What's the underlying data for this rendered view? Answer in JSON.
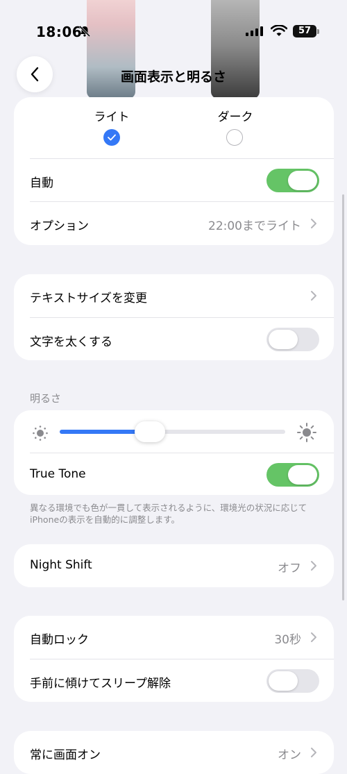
{
  "status_bar": {
    "time": "18:06",
    "battery": "57"
  },
  "nav": {
    "title": "画面表示と明るさ"
  },
  "appearance": {
    "options": [
      {
        "label": "ライト",
        "selected": true
      },
      {
        "label": "ダーク",
        "selected": false
      }
    ]
  },
  "appearance_settings": {
    "auto_label": "自動",
    "auto_on": true,
    "options_label": "オプション",
    "options_value": "22:00までライト"
  },
  "text_settings": {
    "text_size_label": "テキストサイズを変更",
    "bold_label": "文字を太くする",
    "bold_on": false
  },
  "brightness": {
    "header": "明るさ",
    "level_fraction": 0.4,
    "true_tone_label": "True Tone",
    "true_tone_on": true,
    "footer": "異なる環境でも色が一貫して表示されるように、環境光の状況に応じてiPhoneの表示を自動的に調整します。"
  },
  "night_shift": {
    "label": "Night Shift",
    "value": "オフ"
  },
  "lock_settings": {
    "auto_lock_label": "自動ロック",
    "auto_lock_value": "30秒",
    "raise_to_wake_label": "手前に傾けてスリープ解除",
    "raise_to_wake_on": false
  },
  "always_on": {
    "label": "常に画面オン",
    "value": "オン"
  },
  "colors": {
    "accent": "#3478f6",
    "toggle_on": "#65c466",
    "background": "#f2f2f7"
  }
}
